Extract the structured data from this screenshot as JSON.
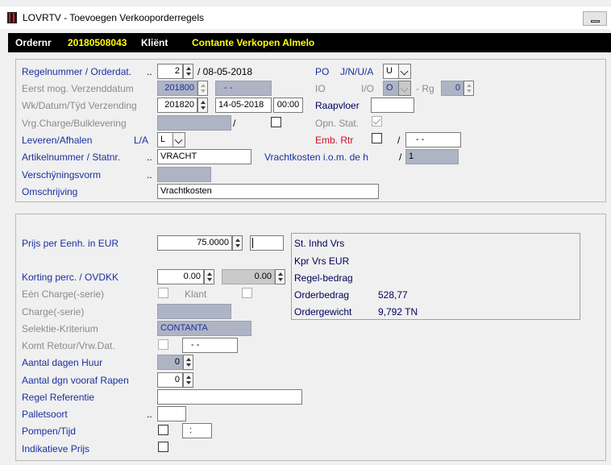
{
  "window": {
    "title": "LOVRTV - Toevoegen Verkooporderregels",
    "minimize": "minimize-button"
  },
  "order_bar": {
    "ordernr_label": "Ordernr",
    "ordernr_value": "20180508043",
    "klient_label": "Kliënt",
    "klient_value": "Contante Verkopen Almelo"
  },
  "top": {
    "regelnummer_label": "Regelnummer / Orderdat.",
    "regelnummer_dots": "..",
    "regelnummer_value": "2",
    "orderdat_value": "/ 08-05-2018",
    "eerst_label": "Eerst mog. Verzenddatum",
    "eerst_week": "201800",
    "eerst_date": "- -",
    "wk_label": "Wk/Datum/Tÿd Verzending",
    "wk_week": "201820",
    "wk_date": "14-05-2018",
    "wk_time": "00:00",
    "vrg_label": "Vrg.Charge/Bulklevering",
    "vrg_slash": "/",
    "leveren_label": "Leveren/Afhalen",
    "la_label": "L/A",
    "la_value": "L",
    "artikel_label": "Artikelnummer / Statnr.",
    "artikel_dots": "..",
    "artikel_value": "VRACHT",
    "vracht_label": "Vrachtkosten i.o.m. de h",
    "vracht_slash": "/",
    "vracht_value": "1",
    "versch_label": "Verschÿningsvorm",
    "versch_dots": "..",
    "omschr_label": "Omschrijving",
    "omschr_value": "Vrachtkosten",
    "po_label": "PO",
    "po_options_label": "J/N/U/A",
    "po_value": "U",
    "io_label": "IO",
    "io_io_label": "I/O",
    "io_value": "O",
    "rg_label": "- Rg",
    "rg_value": "0",
    "raapvloer_label": "Raapvloer",
    "opn_label": "Opn. Stat.",
    "emb_label": "Emb. Rtr",
    "emb_slash": "/",
    "emb_value": "- -"
  },
  "bottom": {
    "prijs_label": "Prijs per Eenh. in EUR",
    "prijs_value": "75.0000",
    "korting_label": "Korting perc. / OVDKK",
    "korting_value": "0.00",
    "ovdkk_value": "0.00",
    "een_charge_label": "Eén Charge(-serie)",
    "klant_label": "Klant",
    "charge_label": "Charge(-serie)",
    "selektie_label": "Selektie-Kriterium",
    "selektie_value": "CONTANTA",
    "komt_label": "Komt Retour/Vrw.Dat.",
    "komt_value": "- -",
    "aantal_huur_label": "Aantal dagen Huur",
    "aantal_huur_value": "0",
    "aantal_rapen_label": "Aantal dgn vooraf Rapen",
    "aantal_rapen_value": "0",
    "regel_ref_label": "Regel Referentie",
    "pallet_label": "Palletsoort",
    "pallet_dots": "..",
    "pompen_label": "Pompen/Tijd",
    "pompen_value": ":",
    "indik_label": "Indikatieve Prijs"
  },
  "info": {
    "st_inhd": "St. Inhd Vrs",
    "kpr_vrs": "Kpr Vrs  EUR",
    "regel_bedrag": "Regel-bedrag",
    "orderbedrag_label": "Orderbedrag",
    "orderbedrag_value": "528,77",
    "ordergewicht_label": "Ordergewicht",
    "ordergewicht_value": "9,792 TN"
  },
  "colors": {
    "label_blue": "#1c2fa0",
    "order_yellow": "#ffff00",
    "emb_red": "#c8102e",
    "disabled_fill": "#aeb4c4"
  }
}
